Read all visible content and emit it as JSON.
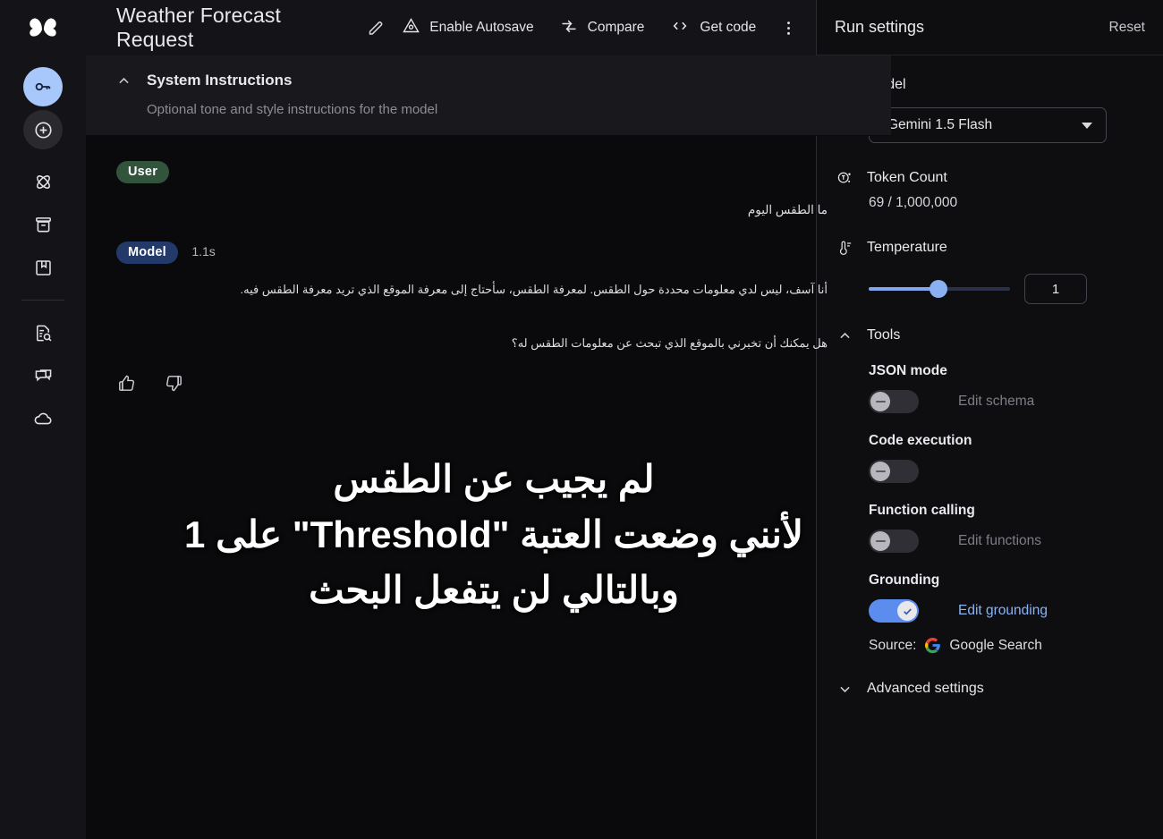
{
  "app": {
    "logo_icon": "butterfly-logo-icon"
  },
  "rail": {
    "items": [
      {
        "name": "api-key",
        "icon": "key-icon"
      },
      {
        "name": "new-chat",
        "icon": "plus-circle-icon"
      },
      {
        "name": "tune-model",
        "icon": "atom-icon"
      },
      {
        "name": "library",
        "icon": "archive-icon"
      },
      {
        "name": "book",
        "icon": "book-icon"
      },
      {
        "name": "docs-search",
        "icon": "document-search-icon"
      },
      {
        "name": "feedback-chat",
        "icon": "chat-bubbles-icon"
      },
      {
        "name": "cloud",
        "icon": "cloud-icon"
      }
    ]
  },
  "header": {
    "title": "Weather Forecast Request",
    "edit_icon": "pencil-icon",
    "actions": [
      {
        "label": "Enable Autosave",
        "icon": "save-triangle-icon"
      },
      {
        "label": "Compare",
        "icon": "compare-arrows-icon"
      },
      {
        "label": "Get code",
        "icon": "code-brackets-icon"
      }
    ],
    "overflow_icon": "kebab-menu-icon"
  },
  "system_instructions": {
    "title": "System Instructions",
    "placeholder": "Optional tone and style instructions for the model",
    "collapse_icon": "chevron-up-icon"
  },
  "chat": {
    "turns": [
      {
        "role_label": "User",
        "role_color": "#33543c",
        "text": "ما الطقس اليوم"
      },
      {
        "role_label": "Model",
        "role_color": "#22396a",
        "latency": "1.1s",
        "paragraph1": "أنا آسف، ليس لدي معلومات محددة حول الطقس. لمعرفة الطقس، سأحتاج إلى معرفة الموقع الذي تريد معرفة الطقس فيه.",
        "paragraph2": "هل يمكنك أن تخبرني بالموقع الذي تبحث عن معلومات الطقس له؟"
      }
    ],
    "feedback": {
      "thumbs_up_icon": "thumbs-up-icon",
      "thumbs_down_icon": "thumbs-down-icon"
    }
  },
  "overlay_caption": {
    "line1": "لم يجيب عن الطقس",
    "line2": "لأنني وضعت العتبة \"Threshold\" على 1",
    "line3": "وبالتالي لن يتفعل البحث",
    "color": "#ffffff"
  },
  "run_settings": {
    "title": "Run settings",
    "reset_label": "Reset",
    "model": {
      "label": "Model",
      "icon": "atom-icon",
      "selected": "Gemini 1.5 Flash",
      "caret_icon": "chevron-down-icon"
    },
    "token_count": {
      "label": "Token Count",
      "icon": "token-icon",
      "value": "69 / 1,000,000"
    },
    "temperature": {
      "label": "Temperature",
      "icon": "thermometer-icon",
      "value": "1",
      "min": 0,
      "max": 2,
      "fill_percent": 49
    },
    "tools": {
      "label": "Tools",
      "collapse_icon": "chevron-up-icon",
      "items": [
        {
          "name": "JSON mode",
          "enabled": false,
          "link": "Edit schema",
          "link_active": false
        },
        {
          "name": "Code execution",
          "enabled": false,
          "link": "",
          "link_active": false
        },
        {
          "name": "Function calling",
          "enabled": false,
          "link": "Edit functions",
          "link_active": false
        },
        {
          "name": "Grounding",
          "enabled": true,
          "link": "Edit grounding",
          "link_active": true
        }
      ],
      "source_label": "Source:",
      "source_name": "Google Search",
      "source_icon": "google-g-icon"
    },
    "advanced": {
      "label": "Advanced settings",
      "expand_icon": "chevron-down-icon"
    }
  }
}
